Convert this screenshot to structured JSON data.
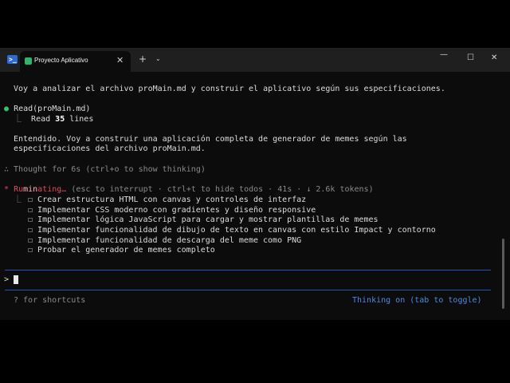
{
  "tab": {
    "title": "Proyecto Aplicativo"
  },
  "icons": {
    "shell": "powershell-icon",
    "tab": "terminal-app-icon"
  },
  "colors": {
    "accent": "#2553b8",
    "success": "#2fc36a",
    "status": "#e0475a",
    "background": "#0c0c0c"
  },
  "terminal": {
    "intro": "Voy a analizar el archivo proMain.md y construir el aplicativo según sus especificaciones.",
    "read": {
      "bullet": "●",
      "label": "Read",
      "arg": "(proMain.md)",
      "result_prefix": "Read",
      "result_count": "35",
      "result_suffix": "lines"
    },
    "understood_1": "Entendido. Voy a construir una aplicación completa de generador de memes según las",
    "understood_2": "especificaciones del archivo proMain.md.",
    "thought": "∴ Thought for 6s (ctrl+o to show thinking)",
    "status": {
      "star": "*",
      "word_pre": "Ru",
      "word_mid": "min",
      "word_post": "ating…",
      "details": "(esc to interrupt · ctrl+t to hide todos · 41s · ↓ 2.6k tokens)"
    },
    "todos": [
      "Crear estructura HTML con canvas y controles de interfaz",
      "Implementar CSS moderno con gradientes y diseño responsive",
      "Implementar lógica JavaScript para cargar y mostrar plantillas de memes",
      "Implementar funcionalidad de dibujo de texto en canvas con estilo Impact y contorno",
      "Implementar funcionalidad de descarga del meme como PNG",
      "Probar el generador de memes completo"
    ],
    "prompt": ">",
    "shortcuts": "? for shortcuts",
    "thinking": "Thinking on (tab to toggle)"
  }
}
